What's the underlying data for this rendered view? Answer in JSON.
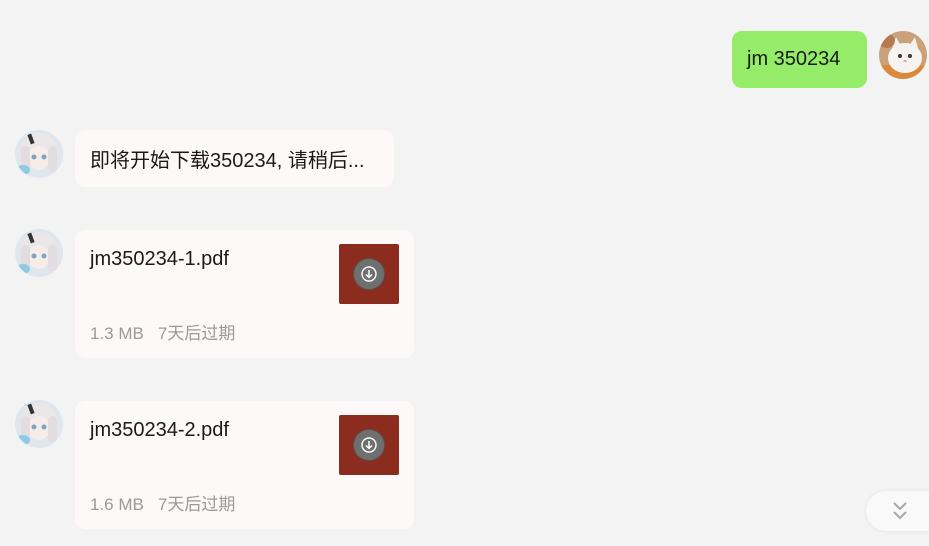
{
  "messages": {
    "sent_1": {
      "text": "jm 350234"
    },
    "received_1": {
      "text": "即将开始下载350234, 请稍后..."
    },
    "files": [
      {
        "name": "jm350234-1.pdf",
        "size": "1.3 MB",
        "expiry": "7天后过期",
        "icon": "pdf-file-icon"
      },
      {
        "name": "jm350234-2.pdf",
        "size": "1.6 MB",
        "expiry": "7天后过期",
        "icon": "pdf-file-icon"
      }
    ]
  },
  "avatars": {
    "self": "cat-avatar",
    "bot": "anime-girl-avatar"
  },
  "colors": {
    "background": "#f3f3f3",
    "sent_bubble": "#95ec69",
    "received_bubble": "#fcf9f8",
    "file_icon_bg": "#8b2c1e",
    "meta_text": "#9a9a9a"
  },
  "scroll_button": {
    "icon": "double-chevron-down-icon"
  }
}
